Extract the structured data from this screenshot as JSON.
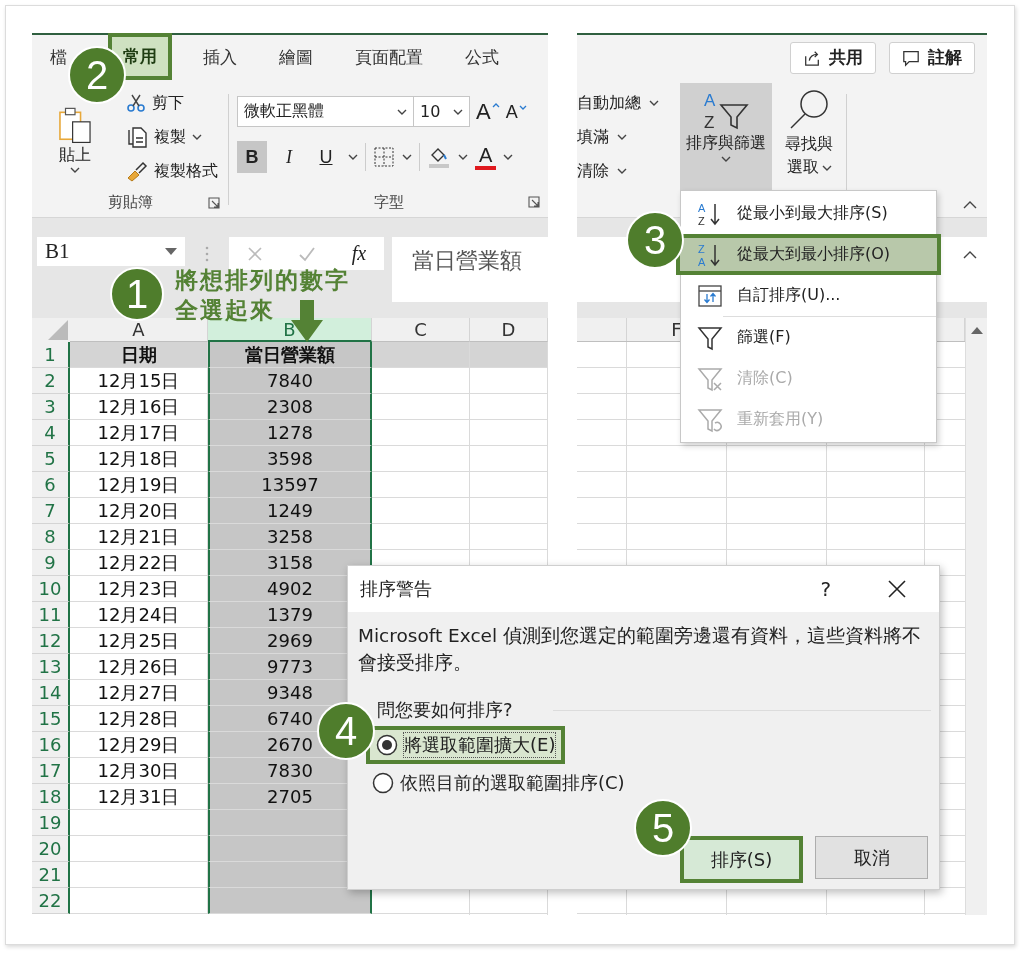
{
  "ribbon_tabs": {
    "badge": "2",
    "tabs": [
      {
        "label": "檔",
        "selected": false
      },
      {
        "label": "常用",
        "selected": true
      },
      {
        "label": "插入",
        "selected": false
      },
      {
        "label": "繪圖",
        "selected": false
      },
      {
        "label": "頁面配置",
        "selected": false
      },
      {
        "label": "公式",
        "selected": false
      }
    ]
  },
  "clipboard": {
    "paste": "貼上",
    "cut": "剪下",
    "copy": "複製",
    "format_painter": "複製格式",
    "group_label": "剪貼簿"
  },
  "font": {
    "name": "微軟正黑體",
    "size": "10",
    "grow": "A",
    "shrink": "A",
    "styles": [
      {
        "glyph": "B",
        "kind": "bold",
        "on": true
      },
      {
        "glyph": "I",
        "kind": "italic",
        "on": false
      },
      {
        "glyph": "U",
        "kind": "underline",
        "on": false
      }
    ],
    "font_color": "A",
    "group_label": "字型"
  },
  "formula_bar": {
    "name_box": "B1",
    "fx": "fx",
    "content": "當日營業額"
  },
  "annotation": {
    "badge": "1",
    "lines": [
      "將想排列的數字",
      "全選起來"
    ]
  },
  "sheet": {
    "columns": [
      {
        "label": "A",
        "selected": false
      },
      {
        "label": "B",
        "selected": true
      },
      {
        "label": "C",
        "selected": false
      },
      {
        "label": "D",
        "selected": false
      }
    ],
    "rows": [
      {
        "header": "1",
        "kind": "header",
        "cells": [
          "日期",
          "當日營業額"
        ]
      },
      {
        "header": "2",
        "kind": "data",
        "cells": [
          "12月15日",
          "7840"
        ]
      },
      {
        "header": "3",
        "kind": "data",
        "cells": [
          "12月16日",
          "2308"
        ]
      },
      {
        "header": "4",
        "kind": "data",
        "cells": [
          "12月17日",
          "1278"
        ]
      },
      {
        "header": "5",
        "kind": "data",
        "cells": [
          "12月18日",
          "3598"
        ]
      },
      {
        "header": "6",
        "kind": "data",
        "cells": [
          "12月19日",
          "13597"
        ]
      },
      {
        "header": "7",
        "kind": "data",
        "cells": [
          "12月20日",
          "1249"
        ]
      },
      {
        "header": "8",
        "kind": "data",
        "cells": [
          "12月21日",
          "3258"
        ]
      },
      {
        "header": "9",
        "kind": "data",
        "cells": [
          "12月22日",
          "3158"
        ]
      },
      {
        "header": "10",
        "kind": "data",
        "cells": [
          "12月23日",
          "4902"
        ]
      },
      {
        "header": "11",
        "kind": "data",
        "cells": [
          "12月24日",
          "1379"
        ]
      },
      {
        "header": "12",
        "kind": "data",
        "cells": [
          "12月25日",
          "2969"
        ]
      },
      {
        "header": "13",
        "kind": "data",
        "cells": [
          "12月26日",
          "9773"
        ]
      },
      {
        "header": "14",
        "kind": "data",
        "cells": [
          "12月27日",
          "9348"
        ]
      },
      {
        "header": "15",
        "kind": "data",
        "cells": [
          "12月28日",
          "6740"
        ]
      },
      {
        "header": "16",
        "kind": "data",
        "cells": [
          "12月29日",
          "2670"
        ]
      },
      {
        "header": "17",
        "kind": "data",
        "cells": [
          "12月30日",
          "7830"
        ]
      },
      {
        "header": "18",
        "kind": "data",
        "cells": [
          "12月31日",
          "2705"
        ]
      },
      {
        "header": "19",
        "kind": "data"
      },
      {
        "header": "20",
        "kind": "data"
      },
      {
        "header": "21",
        "kind": "data"
      },
      {
        "header": "22",
        "kind": "data"
      }
    ]
  },
  "share_button": "共用",
  "comments_button": "註解",
  "editing": {
    "items": [
      "自動加總",
      "填滿",
      "清除"
    ],
    "sort_filter": {
      "icon_letters": [
        "A",
        "Z"
      ],
      "label": "排序與篩選",
      "pressed": true
    },
    "find": {
      "lines": [
        "尋找與",
        "選取"
      ]
    }
  },
  "right_sheet": {
    "column": "F"
  },
  "sort_menu": {
    "badge": "3",
    "groups": [
      [
        {
          "label": "從最小到最大排序(S)",
          "kind": "ascending",
          "icon_letters": [
            "A",
            "Z"
          ],
          "highlighted": false,
          "disabled": false
        },
        {
          "label": "從最大到最小排序(O)",
          "kind": "descending",
          "icon_letters": [
            "Z",
            "A"
          ],
          "highlighted": true,
          "disabled": false
        },
        {
          "label": "自訂排序(U)...",
          "kind": "custom",
          "highlighted": false,
          "disabled": false
        }
      ],
      [
        {
          "label": "篩選(F)",
          "kind": "filter",
          "highlighted": false,
          "disabled": false
        },
        {
          "label": "清除(C)",
          "kind": "clear",
          "highlighted": false,
          "disabled": true
        },
        {
          "label": "重新套用(Y)",
          "kind": "reapply",
          "highlighted": false,
          "disabled": true
        }
      ]
    ]
  },
  "dialog": {
    "title": "排序警告",
    "help": "?",
    "message": "Microsoft Excel 偵測到您選定的範圍旁邊還有資料，這些資料將不會接受排序。",
    "question": "問您要如何排序?",
    "option_badge": "4",
    "options": [
      {
        "label": "將選取範圍擴大(E)",
        "selected": true,
        "highlighted": true
      },
      {
        "label": "依照目前的選取範圍排序(C)",
        "selected": false,
        "highlighted": false
      }
    ],
    "button_badge": "5",
    "buttons": [
      {
        "label": "排序(S)",
        "highlighted": true
      },
      {
        "label": "取消",
        "highlighted": false
      }
    ]
  }
}
